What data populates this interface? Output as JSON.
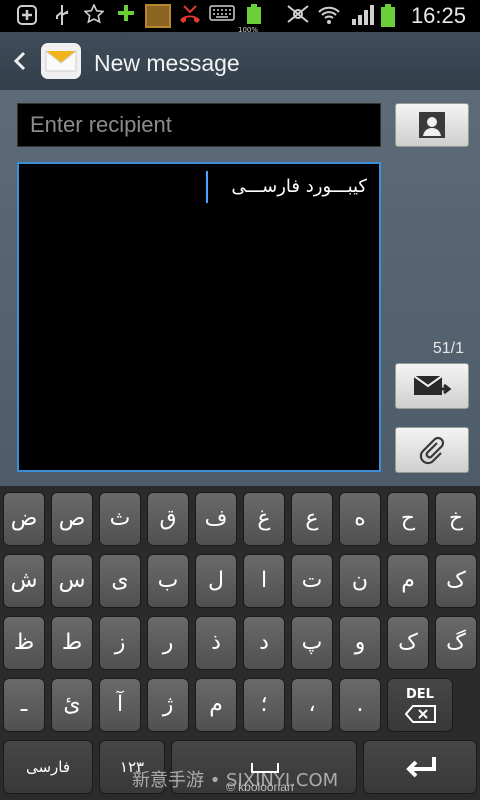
{
  "status_bar": {
    "time": "16:25",
    "battery_text": "100%",
    "icons": [
      "add-icon",
      "usb-icon",
      "star-icon",
      "plus-icon",
      "app-thumbnail-icon",
      "missed-call-icon",
      "keyboard-icon",
      "battery-icon",
      "mute-icon",
      "wifi-icon",
      "signal-icon",
      "battery-full-icon"
    ]
  },
  "header": {
    "title": "New message"
  },
  "compose": {
    "recipient_placeholder": "Enter recipient",
    "message_text": "کیبـــورد فارســـی",
    "counter": "51/1"
  },
  "keyboard": {
    "row1": [
      "ض",
      "ص",
      "ث",
      "ق",
      "ف",
      "غ",
      "ع",
      "ه",
      "خ",
      "ح"
    ],
    "row2": [
      "ش",
      "س",
      "ی",
      "ب",
      "ل",
      "ا",
      "ت",
      "ن",
      "م",
      "ک"
    ],
    "row3": [
      "ظ",
      "ط",
      "ز",
      "ر",
      "ذ",
      "د",
      "پ",
      "و",
      "ک",
      "گ"
    ],
    "row4": [
      "ـ",
      "ئ",
      "آ",
      "ژ",
      "م",
      "؛",
      "،",
      "."
    ],
    "del_label": "DEL",
    "lang_label": "فارسی",
    "numbers_label": "۱۲۳"
  },
  "watermark": {
    "text": "新意手游 • SIXINYI.COM",
    "credit": "© kboloorian"
  },
  "colors": {
    "accent": "#3a8fd6",
    "keyboard_bg": "#2b2b2b",
    "header_bg": "#3a4652"
  }
}
